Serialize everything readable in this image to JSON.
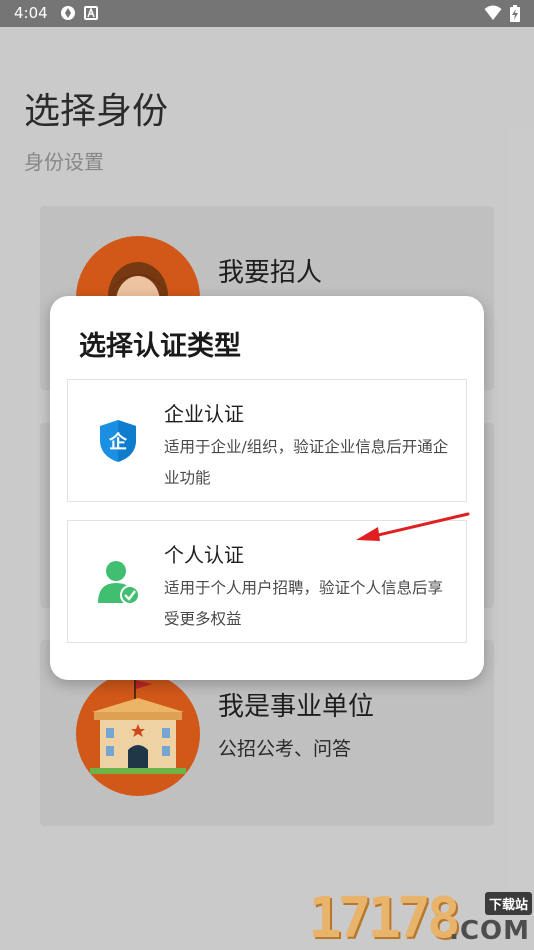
{
  "status_bar": {
    "time": "4:04",
    "left_icons": [
      "sync-icon",
      "a-badge-icon"
    ],
    "right_icons": [
      "wifi-icon",
      "battery-charging-icon"
    ]
  },
  "page": {
    "title": "选择身份",
    "subtitle": "身份设置"
  },
  "cards": {
    "recruit": {
      "title": "我要招人"
    },
    "institution": {
      "title": "我是事业单位",
      "desc": "公招公考、问答"
    }
  },
  "dialog": {
    "title": "选择认证类型",
    "options": [
      {
        "title": "企业认证",
        "desc": "适用于企业/组织，验证企业信息后开通企业功能",
        "icon": "shield-enterprise-icon",
        "icon_glyph": "企"
      },
      {
        "title": "个人认证",
        "desc": "适用于个人用户招聘，验证个人信息后享受更多权益",
        "icon": "person-verified-icon"
      }
    ]
  },
  "annotation": {
    "arrow_color": "#e02020"
  },
  "watermark": {
    "digits": "17178",
    "badge": "下载站",
    "suffix": ".COM"
  },
  "colors": {
    "enterprise": "#1a8fe3",
    "personal": "#3fbf6f",
    "accent_orange": "#d65a1a"
  }
}
